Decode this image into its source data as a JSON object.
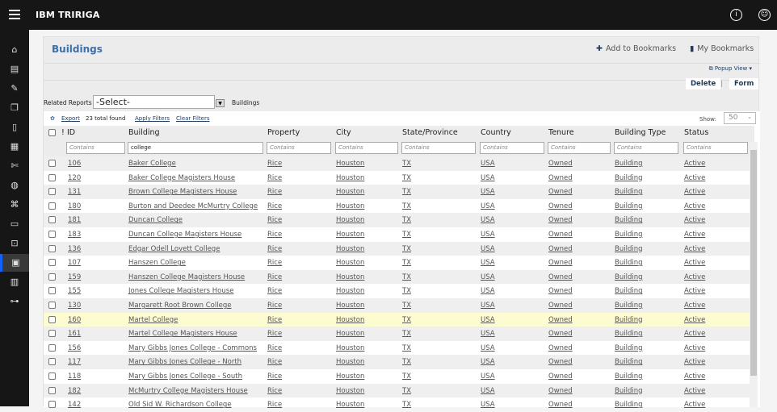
{
  "app": {
    "title": "IBM TRIRIGA",
    "info_icon": "info-icon",
    "user_icon": "user-icon"
  },
  "sidebar": [
    "home",
    "clipboard",
    "edit",
    "copy",
    "document",
    "dashboard",
    "tools",
    "globe",
    "network",
    "report",
    "briefcase",
    "portfolio",
    "archive",
    "hierarchy"
  ],
  "page": {
    "title": "Buildings",
    "add_bookmarks": "Add to Bookmarks",
    "my_bookmarks": "My Bookmarks",
    "popup_view": "Popup View",
    "delete": "Delete",
    "separator": "|",
    "form": "Form"
  },
  "reports": {
    "label": "Related Reports",
    "select": "-Select-",
    "name": "Buildings"
  },
  "toolbar": {
    "export": "Export",
    "total": "23 total found",
    "apply": "Apply Filters",
    "clear": "Clear Filters",
    "show_label": "Show:",
    "show_value": "50"
  },
  "columns": [
    "!",
    "ID",
    "Building",
    "Property",
    "City",
    "State/Province",
    "Country",
    "Tenure",
    "Building Type",
    "Status"
  ],
  "filters": {
    "placeholder": "Contains",
    "building": "college"
  },
  "rows": [
    [
      "106",
      "Baker College"
    ],
    [
      "120",
      "Baker College Magisters House"
    ],
    [
      "131",
      "Brown College Magisters House"
    ],
    [
      "180",
      "Burton and Deedee McMurtry College"
    ],
    [
      "181",
      "Duncan College"
    ],
    [
      "183",
      "Duncan College Magisters House"
    ],
    [
      "136",
      "Edgar Odell Lovett College"
    ],
    [
      "107",
      "Hanszen College"
    ],
    [
      "159",
      "Hanszen College Magisters House"
    ],
    [
      "155",
      "Jones College Magisters House"
    ],
    [
      "130",
      "Margarett Root Brown College"
    ],
    [
      "160",
      "Martel College"
    ],
    [
      "161",
      "Martel College Magisters House"
    ],
    [
      "156",
      "Mary Gibbs Jones College - Commons"
    ],
    [
      "117",
      "Mary Gibbs Jones College - North"
    ],
    [
      "118",
      "Mary Gibbs Jones College - South"
    ],
    [
      "182",
      "McMurtry College Magisters House"
    ],
    [
      "142",
      "Old Sid W. Richardson College"
    ]
  ],
  "common": {
    "property": "Rice",
    "city": "Houston",
    "state": "TX",
    "country": "USA",
    "tenure": "Owned",
    "type": "Building",
    "status": "Active"
  },
  "highlight_id": "160"
}
